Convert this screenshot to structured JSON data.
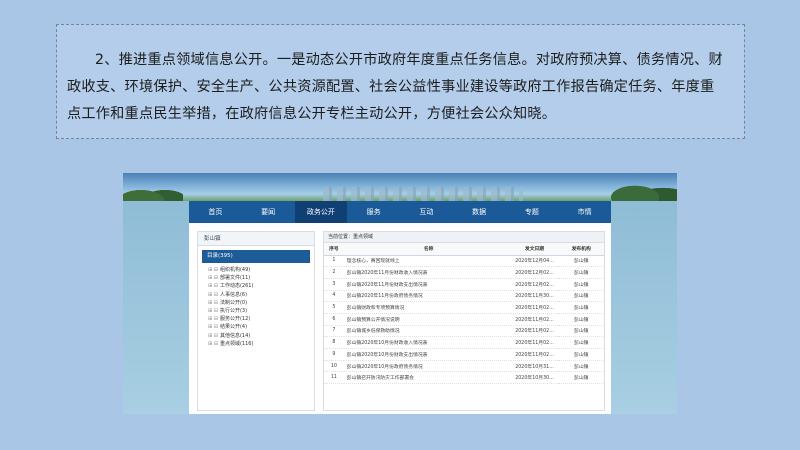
{
  "paragraph": "2、推进重点领域信息公开。一是动态公开市政府年度重点任务信息。对政府预决算、债务情况、财政收支、环境保护、安全生产、公共资源配置、社会公益性事业建设等政府工作报告确定任务、年度重点工作和重点民生举措，在政府信息公开专栏主动公开，方便社会公众知晓。",
  "nav": [
    "首页",
    "要闻",
    "政务公开",
    "服务",
    "互动",
    "数据",
    "专题",
    "市情"
  ],
  "nav_active_index": 2,
  "sidebar": {
    "header": "彭山镇",
    "directory": "目录(395)",
    "items": [
      "组织机构(49)",
      "部署文件(11)",
      "工作动态(261)",
      "人事信息(6)",
      "法制公开(0)",
      "执行公开(3)",
      "服务公开(12)",
      "结果公开(4)",
      "其他信息(14)",
      "重点领域(116)"
    ]
  },
  "breadcrumb": "当前位置：重点领域",
  "table": {
    "headers": [
      "序号",
      "名称",
      "发文日期",
      "发布机构"
    ],
    "rows": [
      [
        "1",
        "理念核心，赛回现就线上",
        "2020年12月04...",
        "彭山镇"
      ],
      [
        "2",
        "彭山镇2020年11月份财政收入情况表",
        "2020年12月02...",
        "彭山镇"
      ],
      [
        "3",
        "彭山镇2020年11月份财政支出情况表",
        "2020年12月02...",
        "彭山镇"
      ],
      [
        "4",
        "彭山镇2020年11月份政府债务情况",
        "2020年11月30...",
        "彭山镇"
      ],
      [
        "5",
        "彭山镇财政和专项预算情况",
        "2020年11月02...",
        "彭山镇"
      ],
      [
        "6",
        "彭山镇预算公开情况说明",
        "2020年11月02...",
        "彭山镇"
      ],
      [
        "7",
        "彭山镇城乡低保救助情况",
        "2020年11月02...",
        "彭山镇"
      ],
      [
        "8",
        "彭山镇2020年10月份财政收入情况表",
        "2020年11月02...",
        "彭山镇"
      ],
      [
        "9",
        "彭山镇2020年10月份财政支出情况表",
        "2020年11月02...",
        "彭山镇"
      ],
      [
        "10",
        "彭山镇2020年10月份政府债务情况",
        "2020年10月31...",
        "彭山镇"
      ],
      [
        "11",
        "彭山镇召开防汛防灾工作部署会",
        "2020年10月30...",
        "彭山镇"
      ]
    ]
  }
}
